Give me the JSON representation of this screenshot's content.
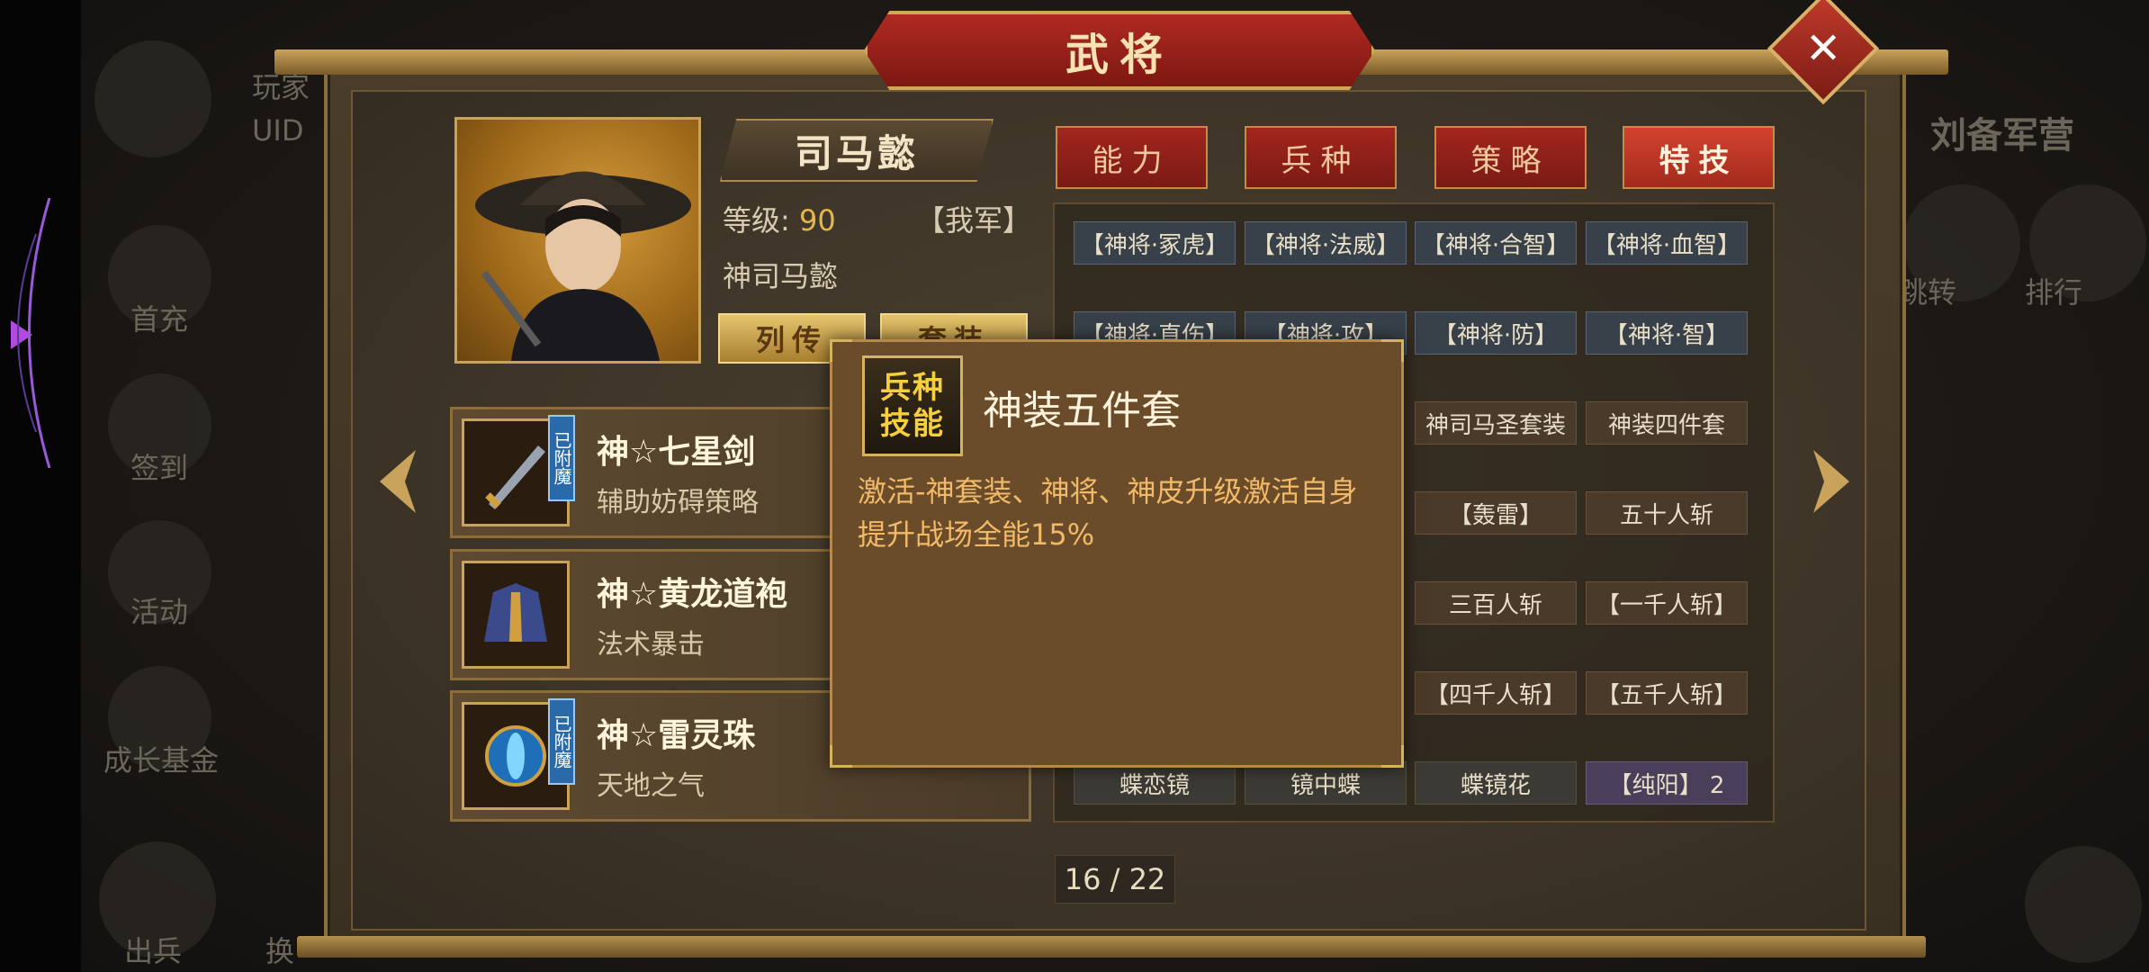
{
  "window": {
    "title": "武将",
    "close_icon": "close-icon"
  },
  "background": {
    "player_label": "玩家",
    "uid_label": "UID",
    "camp_label": "刘备军营",
    "left_menu": [
      "首充",
      "签到",
      "活动",
      "成长基金",
      "出兵",
      "换"
    ],
    "right_menu": [
      "跳转",
      "排行"
    ]
  },
  "hero": {
    "name": "司马懿",
    "level_label": "等级:",
    "level_value": "90",
    "faction": "【我军】",
    "title": "神司马懿",
    "biography_button": "列传",
    "suit_button": "套装"
  },
  "equipment": [
    {
      "name": "神☆七星剑",
      "desc": "辅助妨碍策略",
      "badge": "已附魔",
      "icon": "sword-icon"
    },
    {
      "name": "神☆黄龙道袍",
      "desc": "法术暴击",
      "badge": "",
      "icon": "robe-icon"
    },
    {
      "name": "神☆雷灵珠",
      "desc": "天地之气",
      "badge": "已附魔",
      "icon": "orb-icon"
    }
  ],
  "tabs": [
    {
      "label": "能力",
      "active": false
    },
    {
      "label": "兵种",
      "active": false
    },
    {
      "label": "策略",
      "active": false
    },
    {
      "label": "特技",
      "active": true
    }
  ],
  "skills": [
    [
      "【神将·冢虎】",
      "【神将·法威】",
      "【神将·合智】",
      "【神将·血智】"
    ],
    [
      "【神将·直伤】",
      "【神将·攻】",
      "【神将·防】",
      "【神将·智】"
    ],
    [
      "",
      "",
      "神司马圣套装",
      "神装四件套"
    ],
    [
      "",
      "",
      "【轰雷】",
      "五十人斩"
    ],
    [
      "",
      "",
      "三百人斩",
      "【一千人斩】"
    ],
    [
      "",
      "",
      "【四千人斩】",
      "【五千人斩】"
    ],
    [
      "蝶恋镜",
      "镜中蝶",
      "蝶镜花",
      "【纯阳】 2"
    ]
  ],
  "page": {
    "current": 16,
    "total": 22,
    "text": "16 / 22"
  },
  "popup": {
    "icon_line1": "兵种",
    "icon_line2": "技能",
    "title": "神装五件套",
    "description": "激活-神套装、神将、神皮升级激活自身提升战场全能15%"
  },
  "colors": {
    "accent_red": "#a3261e",
    "gold": "#c9a35c",
    "popup_text": "#f1b968"
  }
}
